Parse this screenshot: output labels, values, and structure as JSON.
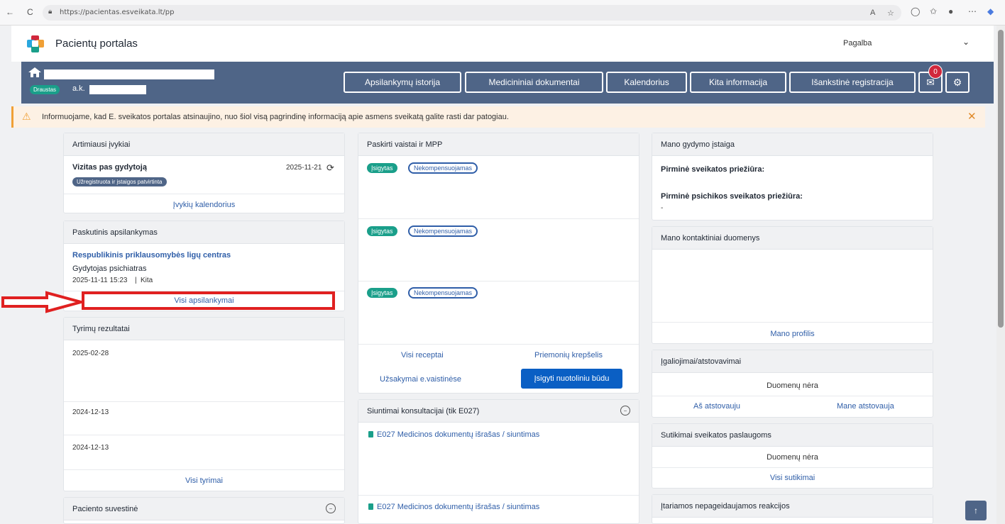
{
  "browser": {
    "url": "https://pacientas.esveikata.lt/pp",
    "back": "←",
    "reload": "C"
  },
  "header": {
    "title": "Pacientų portalas",
    "help": "Pagalba"
  },
  "patient": {
    "status": "Draustas",
    "ak_label": "a.k."
  },
  "nav": {
    "visits": "Apsilankymų istorija",
    "documents": "Medicininiai dokumentai",
    "calendar": "Kalendorius",
    "other": "Kita informacija",
    "registration": "Išankstinė registracija",
    "mail_count": "0"
  },
  "notice": {
    "text": "Informuojame, kad E. sveikatos portalas atsinaujino, nuo šiol visą pagrindinę informaciją apie asmens sveikatą galite rasti dar patogiau."
  },
  "events": {
    "title": "Artimiausi įvykiai",
    "item_title": "Vizitas pas gydytoją",
    "item_date": "2025-11-21",
    "item_status": "Užregistruota ir įstaigos patvirtinta",
    "link": "Įvykių kalendorius"
  },
  "last_visit": {
    "title": "Paskutinis apsilankymas",
    "institution": "Respublikinis priklausomybės ligų centras",
    "doctor": "Gydytojas psichiatras",
    "datetime": "2025-11-11 15:23",
    "type": "Kita",
    "link": "Visi apsilankymai"
  },
  "results": {
    "title": "Tyrimų rezultatai",
    "dates": [
      "2025-02-28",
      "2024-12-13",
      "2024-12-13"
    ],
    "link": "Visi tyrimai"
  },
  "summary": {
    "title": "Paciento suvestinė"
  },
  "meds": {
    "title": "Paskirti vaistai ir MPP",
    "status": "Įsigytas",
    "comp": "Nekompensuojamas",
    "link_prescriptions": "Visi receptai",
    "link_cart": "Priemonių krepšelis",
    "link_orders": "Užsakymai e.vaistinėse",
    "buy_button": "Įsigyti nuotoliniu būdu"
  },
  "referrals": {
    "title": "Siuntimai konsultacijai (tik E027)",
    "items": [
      "E027 Medicinos dokumentų išrašas / siuntimas",
      "E027 Medicinos dokumentų išrašas / siuntimas"
    ]
  },
  "institution": {
    "title": "Mano gydymo įstaiga",
    "primary": "Pirminė sveikatos priežiūra:",
    "mental": "Pirminė psichikos sveikatos priežiūra:",
    "mental_value": "-"
  },
  "contacts": {
    "title": "Mano kontaktiniai duomenys",
    "link": "Mano profilis"
  },
  "authorizations": {
    "title": "Įgaliojimai/atstovavimai",
    "empty": "Duomenų nėra",
    "i_represent": "Aš atstovauju",
    "represent_me": "Mane atstovauja"
  },
  "consents": {
    "title": "Sutikimai sveikatos paslaugoms",
    "empty": "Duomenų nėra",
    "link": "Visi sutikimai"
  },
  "reactions": {
    "title": "Įtariamos nepageidaujamos reakcijos"
  },
  "colors": {
    "navbar": "#4f6587",
    "accent_green": "#1a9f8a",
    "link": "#2f5ea8",
    "annotation": "#e02020"
  }
}
